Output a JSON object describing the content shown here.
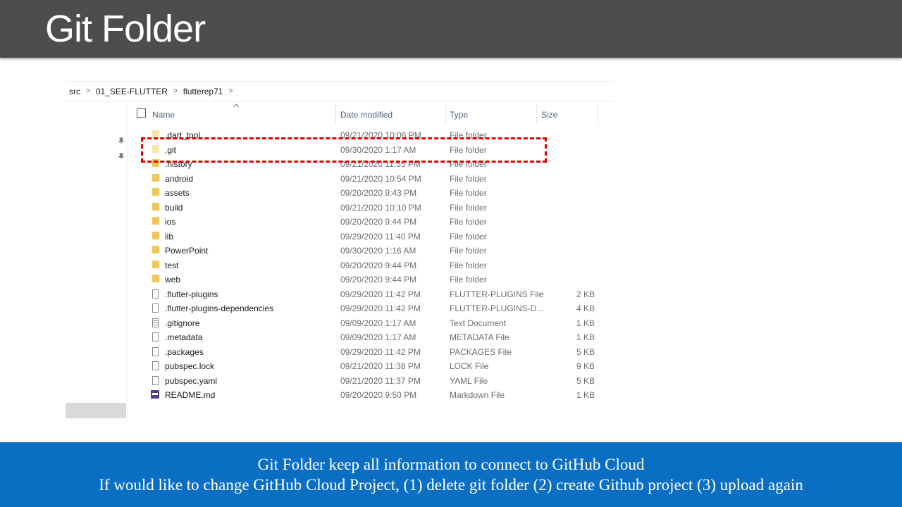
{
  "slide": {
    "title": "Git Folder",
    "caption_line1": "Git Folder keep all information to connect to GitHub Cloud",
    "caption_line2": "If would like to change GitHub Cloud Project,  (1) delete git folder (2) create Github project (3) upload again"
  },
  "explorer": {
    "breadcrumb": [
      "src",
      "01_SEE-FLUTTER",
      "flutterep71"
    ],
    "breadcrumb_sep": ">",
    "columns": {
      "name": "Name",
      "date": "Date modified",
      "type": "Type",
      "size": "Size"
    },
    "files": [
      {
        "name": ".dart_tool",
        "date": "09/21/2020 10:06 PM",
        "type": "File folder",
        "size": "",
        "icon": "folder-icon",
        "faded": true
      },
      {
        "name": ".git",
        "date": "09/30/2020 1:17 AM",
        "type": "File folder",
        "size": "",
        "icon": "folder-icon",
        "faded": true
      },
      {
        "name": ".history",
        "date": "09/21/2020 11:55 PM",
        "type": "File folder",
        "size": "",
        "icon": "folder-icon",
        "faded": false
      },
      {
        "name": "android",
        "date": "09/21/2020 10:54 PM",
        "type": "File folder",
        "size": "",
        "icon": "folder-icon",
        "faded": false
      },
      {
        "name": "assets",
        "date": "09/20/2020 9:43 PM",
        "type": "File folder",
        "size": "",
        "icon": "folder-icon",
        "faded": false
      },
      {
        "name": "build",
        "date": "09/21/2020 10:10 PM",
        "type": "File folder",
        "size": "",
        "icon": "folder-icon",
        "faded": false
      },
      {
        "name": "ios",
        "date": "09/20/2020 9:44 PM",
        "type": "File folder",
        "size": "",
        "icon": "folder-icon",
        "faded": false
      },
      {
        "name": "lib",
        "date": "09/29/2020 11:40 PM",
        "type": "File folder",
        "size": "",
        "icon": "folder-icon",
        "faded": false
      },
      {
        "name": "PowerPoint",
        "date": "09/30/2020 1:16 AM",
        "type": "File folder",
        "size": "",
        "icon": "folder-icon",
        "faded": false
      },
      {
        "name": "test",
        "date": "09/20/2020 9:44 PM",
        "type": "File folder",
        "size": "",
        "icon": "folder-icon",
        "faded": false
      },
      {
        "name": "web",
        "date": "09/20/2020 9:44 PM",
        "type": "File folder",
        "size": "",
        "icon": "folder-icon",
        "faded": false
      },
      {
        "name": ".flutter-plugins",
        "date": "09/29/2020 11:42 PM",
        "type": "FLUTTER-PLUGINS File",
        "size": "2 KB",
        "icon": "file-icon",
        "faded": false
      },
      {
        "name": ".flutter-plugins-dependencies",
        "date": "09/29/2020 11:42 PM",
        "type": "FLUTTER-PLUGINS-D...",
        "size": "4 KB",
        "icon": "file-icon",
        "faded": false
      },
      {
        "name": ".gitignore",
        "date": "09/09/2020 1:17 AM",
        "type": "Text Document",
        "size": "1 KB",
        "icon": "text-file-icon",
        "faded": false
      },
      {
        "name": ".metadata",
        "date": "09/09/2020 1:17 AM",
        "type": "METADATA File",
        "size": "1 KB",
        "icon": "file-icon",
        "faded": false
      },
      {
        "name": ".packages",
        "date": "09/29/2020 11:42 PM",
        "type": "PACKAGES File",
        "size": "5 KB",
        "icon": "file-icon",
        "faded": false
      },
      {
        "name": "pubspec.lock",
        "date": "09/21/2020 11:38 PM",
        "type": "LOCK File",
        "size": "9 KB",
        "icon": "file-icon",
        "faded": false
      },
      {
        "name": "pubspec.yaml",
        "date": "09/21/2020 11:37 PM",
        "type": "YAML File",
        "size": "5 KB",
        "icon": "file-icon",
        "faded": false
      },
      {
        "name": "README.md",
        "date": "09/20/2020 9:50 PM",
        "type": "Markdown File",
        "size": "1 KB",
        "icon": "markdown-file-icon",
        "faded": false
      }
    ]
  },
  "colors": {
    "title_bar": "#4d4d4d",
    "caption_bar": "#0a6fc2",
    "highlight": "#e00000",
    "folder": "#f1c75b"
  }
}
